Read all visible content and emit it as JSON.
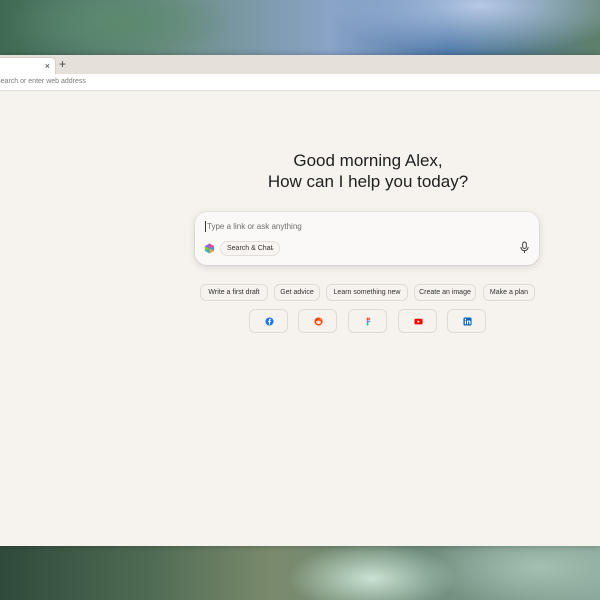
{
  "browser": {
    "tab_close": "×",
    "new_tab": "+",
    "address_placeholder": "Search or enter web address"
  },
  "greeting": {
    "line1": "Good morning Alex,",
    "line2": "How can I help you today?"
  },
  "composer": {
    "placeholder": "Type a link or ask anything",
    "mode_label": "Search & Chat",
    "mode_icon": "chevron-down-icon",
    "mic_icon": "microphone-icon"
  },
  "suggestions": [
    {
      "label": "Write a first draft"
    },
    {
      "label": "Get advice"
    },
    {
      "label": "Learn something new"
    },
    {
      "label": "Create an image"
    },
    {
      "label": "Make a plan"
    }
  ],
  "shortcuts": [
    {
      "icon": "facebook-icon",
      "color": "#1877f2"
    },
    {
      "icon": "reddit-icon",
      "color": "#ff4500"
    },
    {
      "icon": "figma-icon",
      "color": "#a259ff"
    },
    {
      "icon": "youtube-icon",
      "color": "#ff0000"
    },
    {
      "icon": "linkedin-icon",
      "color": "#0a66c2"
    }
  ]
}
